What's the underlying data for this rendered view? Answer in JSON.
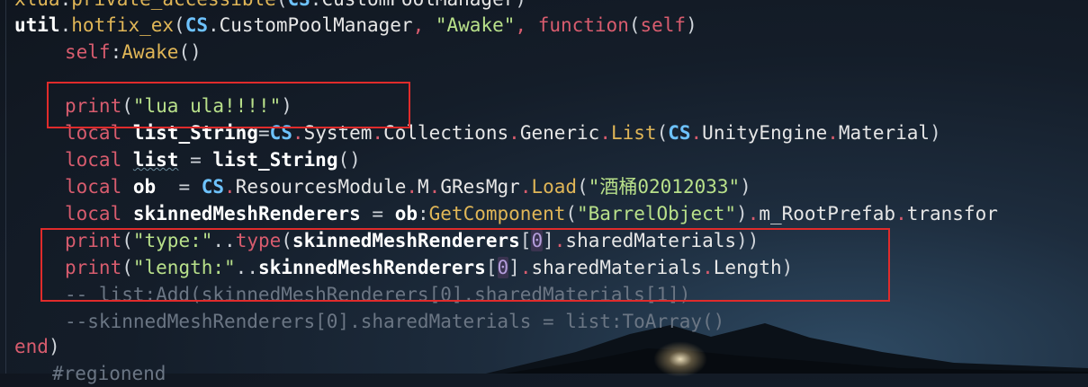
{
  "lines": [
    {
      "tokens": [
        "xlua",
        ".",
        "private_accessible",
        "(",
        "CS",
        ".",
        "CustomPoolManager",
        ")"
      ]
    },
    {
      "tokens": [
        "util",
        ".",
        "hotfix_ex",
        "(",
        "CS",
        ".",
        "CustomPoolManager",
        ", ",
        "\"Awake\"",
        ", ",
        "function",
        "(",
        "self",
        ")"
      ]
    },
    {
      "tokens": [
        "self",
        ":",
        "Awake",
        "()"
      ]
    },
    {
      "tokens": []
    },
    {
      "tokens": [
        "print",
        "(",
        "\"lua ula!!!!\"",
        ")"
      ]
    },
    {
      "tokens": [
        "local",
        " ",
        "list_String",
        "=",
        "CS",
        ".",
        "System",
        ".",
        "Collections",
        ".",
        "Generic",
        ".",
        "List",
        "(",
        "CS",
        ".",
        "UnityEngine",
        ".",
        "Material",
        ")"
      ]
    },
    {
      "tokens": [
        "local",
        " ",
        "list",
        " = ",
        "list_String",
        "()"
      ]
    },
    {
      "tokens": [
        "local",
        " ",
        "ob",
        "  = ",
        "CS",
        ".",
        "ResourcesModule",
        ".",
        "M",
        ".",
        "GResMgr",
        ".",
        "Load",
        "(",
        "\"酒桶02012033\"",
        ")"
      ]
    },
    {
      "tokens": [
        "local",
        " ",
        "skinnedMeshRenderers",
        " = ",
        "ob",
        ":",
        "GetComponent",
        "(",
        "\"BarrelObject\"",
        ")",
        ".",
        "m_RootPrefab",
        ".",
        "transfor"
      ]
    },
    {
      "tokens": [
        "print",
        "(",
        "\"type:\"",
        "..",
        "type",
        "(",
        "skinnedMeshRenderers",
        "[",
        "0",
        "]",
        ".",
        "sharedMaterials",
        "))"
      ]
    },
    {
      "tokens": [
        "print",
        "(",
        "\"length:\"",
        "..",
        "skinnedMeshRenderers",
        "[",
        "0",
        "]",
        ".",
        "sharedMaterials",
        ".",
        "Length",
        ")"
      ]
    },
    {
      "tokens": [
        "-- list:Add(skinnedMeshRenderers[0].sharedMaterials[1])"
      ]
    },
    {
      "tokens": [
        "--skinnedMeshRenderers[0].sharedMaterials = list:ToArray()"
      ]
    },
    {
      "tokens": []
    },
    {
      "tokens": [
        "end",
        ")"
      ]
    },
    {
      "tokens": [
        "#regionend"
      ]
    }
  ],
  "colors": {
    "keyword": "#d85c6e",
    "function": "#e0b657",
    "cs_namespace": "#6ec3ff",
    "string": "#b8e08a",
    "comment": "#6b7684",
    "highlight_box": "#e02b2b"
  }
}
